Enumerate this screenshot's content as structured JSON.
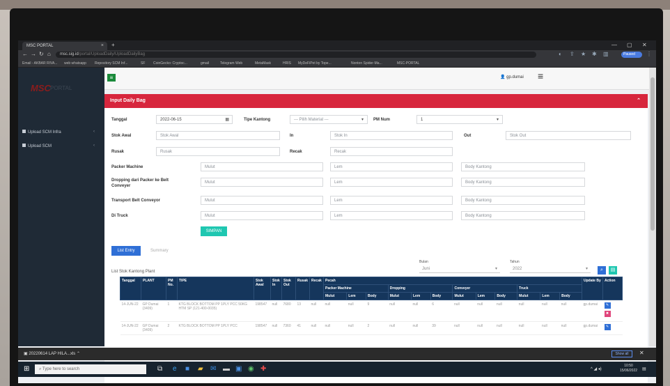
{
  "browser": {
    "tab_title": "MSC PORTAL",
    "tab_close": "×",
    "tab_add": "+",
    "url_host": "msc.sig.id",
    "url_path": "/portal/UploadDaily/UploadDailyBag",
    "profile_label": "Paused",
    "bookmarks": [
      "Email - AKBAR RIVA...",
      "web whatsapp",
      "Repository SCM Inf...",
      "SF",
      "CoinGecko: Cryptoc...",
      "gmail",
      "Telegram Web",
      "MetaMask",
      "HRIS",
      "MyDeFiPet by Tope...",
      "Nonton Spider-Ma...",
      "MSC-PORTAL"
    ]
  },
  "app": {
    "brand": "MSC",
    "brand_sub": "PORTAL",
    "user": "gp.dumai",
    "sidebar": [
      {
        "label": "Upload SCM Infra"
      },
      {
        "label": "Upload SCM"
      }
    ],
    "panel_title": "Input Daily Bag"
  },
  "form": {
    "tanggal_label": "Tanggal",
    "tanggal_value": "2022-06-15",
    "tipe_kantong_label": "Tipe Kantong",
    "tipe_kantong_value": "--- Pilih Material ---",
    "pm_num_label": "PM Num",
    "pm_num_value": "1",
    "stok_awal_label": "Stok Awal",
    "stok_awal_placeholder": "Stok Awal",
    "in_label": "In",
    "in_placeholder": "Stok In",
    "out_label": "Out",
    "out_placeholder": "Stok Out",
    "rusak_label": "Rusak",
    "rusak_placeholder": "Rusak",
    "recak_label": "Recak",
    "recak_placeholder": "Recak",
    "rows": [
      {
        "label": "Packer Machine",
        "mulut": "Mulut",
        "lem": "Lem",
        "body": "Body Kantong"
      },
      {
        "label": "Dropping dari Packer ke Belt Conveyer",
        "mulut": "Mulut",
        "lem": "Lem",
        "body": "Body Kantong"
      },
      {
        "label": "Transport Belt Conveyor",
        "mulut": "Mulut",
        "lem": "Lem",
        "body": "Body Kantong"
      },
      {
        "label": "Di Truck",
        "mulut": "Mulut",
        "lem": "Lem",
        "body": "Body Kantong"
      }
    ],
    "save_label": "SIMPAN"
  },
  "list": {
    "tab_entry": "List Entry",
    "tab_summary": "Summary",
    "title": "List Stok Kantong Plant",
    "bulan_label": "Bulan",
    "bulan_value": "Juni",
    "tahun_label": "Tahun",
    "tahun_value": "2022",
    "headers": {
      "tanggal": "Tanggal",
      "plant": "PLANT",
      "pm_no": "PM No.",
      "tipe": "TIPE",
      "stok_awal": "Stok Awal",
      "stok_in": "Stok In",
      "stok_out": "Stok Out",
      "rusak": "Rusak",
      "recak": "Recak",
      "pecah": "Pecah",
      "packer": "Packer Machine",
      "dropping": "Dropping",
      "conveyer": "Conveyer",
      "truck": "Truck",
      "mulut": "Mulut",
      "lem": "Lem",
      "body": "Body",
      "update_by": "Update By",
      "action": "Action"
    },
    "rows": [
      {
        "tanggal": "14-JUN-22",
        "plant": "GP Dumai (3409)",
        "pm": "1",
        "tipe": "KTG BLOCK BOTTOM PP 1PLY PCC 50KG HTM SP (121-400-0035)",
        "stok_awal": "198547",
        "stok_in": "null",
        "stok_out": "7680",
        "rusak": "13",
        "recak": "null",
        "vals": [
          "null",
          "null",
          "9",
          "null",
          "null",
          "6",
          "null",
          "null",
          "null",
          "null",
          "null",
          "null"
        ],
        "update_by": "gp.dumai"
      },
      {
        "tanggal": "14-JUN-22",
        "plant": "GP Dumai (3409)",
        "pm": "2",
        "tipe": "KTG BLOCK BOTTOM PP 1PLY PCC",
        "stok_awal": "198547",
        "stok_in": "null",
        "stok_out": "7360",
        "rusak": "41",
        "recak": "null",
        "vals": [
          "null",
          "null",
          "2",
          "null",
          "null",
          "39",
          "null",
          "null",
          "null",
          "null",
          "null",
          "null"
        ],
        "update_by": "gp.dumai"
      }
    ]
  },
  "downloads": {
    "file": "20220614 LAP HILA...xls",
    "show_all": "Show all"
  },
  "taskbar": {
    "search": "Type here to search",
    "time": "10:50",
    "date": "15/06/2022"
  },
  "colors": {
    "panel_header": "#d7263d",
    "sidebar": "#1f2a36",
    "table_header": "#15365c",
    "save_button": "#1fc7b1",
    "tab_active": "#2f6fd6"
  }
}
